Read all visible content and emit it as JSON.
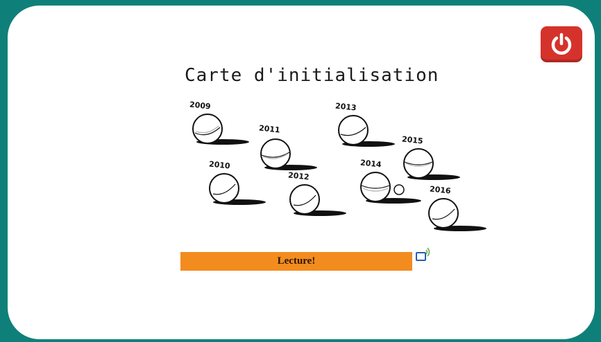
{
  "title": "Carte d'initialisation",
  "years": [
    "2009",
    "2011",
    "2013",
    "2015",
    "2010",
    "2012",
    "2014",
    "2016"
  ],
  "play_label": "Lecture!",
  "icons": {
    "power": "power-icon",
    "audio": "speaker-icon"
  },
  "colors": {
    "background": "#0f8079",
    "card": "#ffffff",
    "power": "#d6322c",
    "bar": "#f28c1f"
  }
}
